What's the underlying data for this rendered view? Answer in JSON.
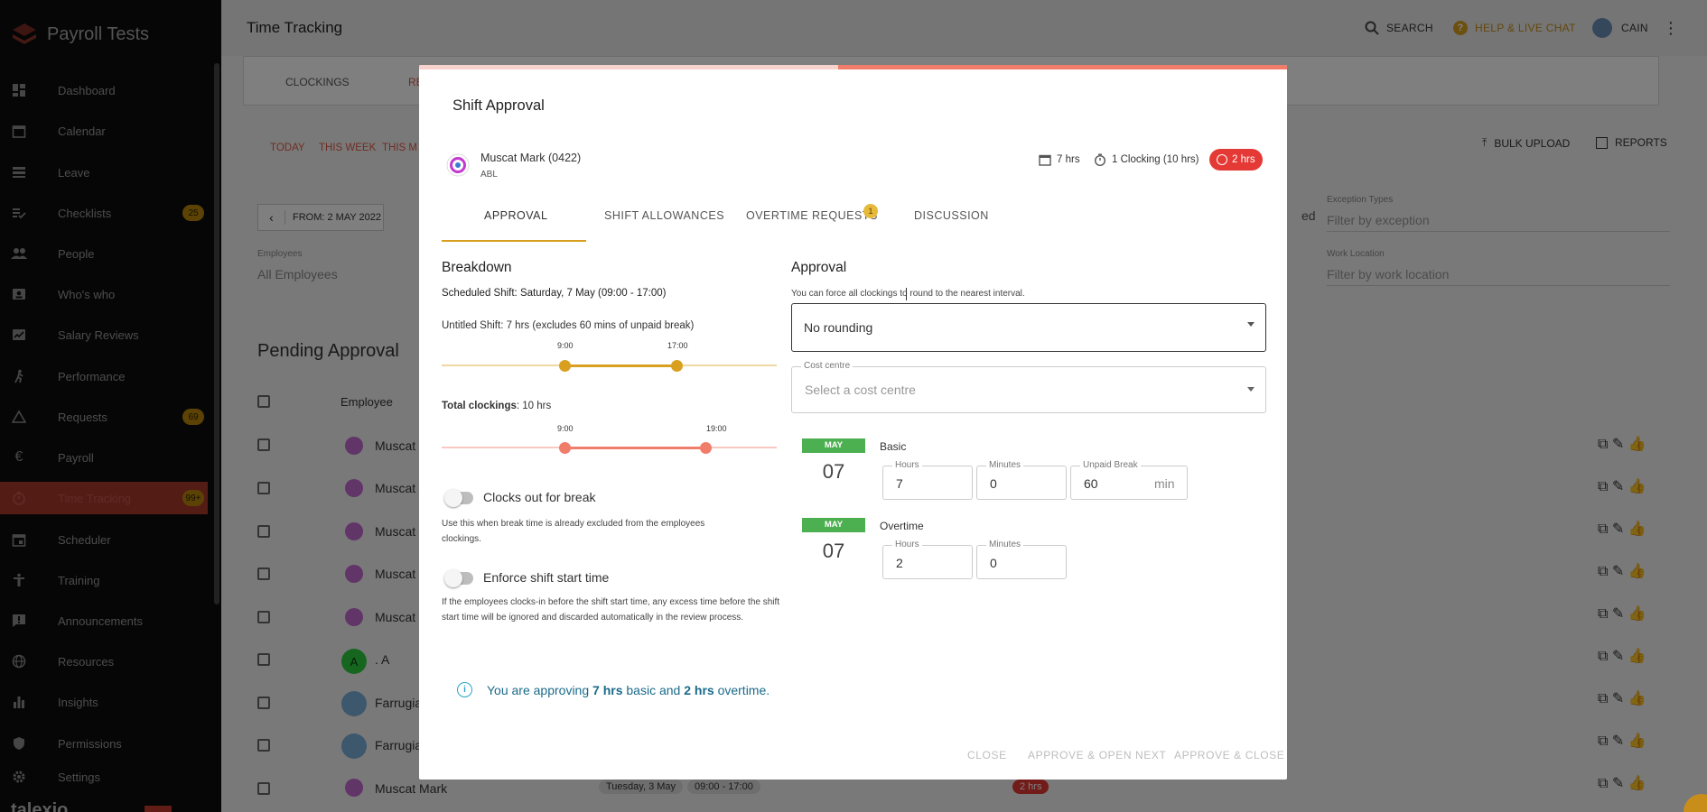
{
  "app": {
    "name": "Payroll Tests"
  },
  "sidebar": {
    "items": [
      {
        "label": "Dashboard",
        "icon": "dashboard-icon"
      },
      {
        "label": "Calendar",
        "icon": "calendar-icon"
      },
      {
        "label": "Leave",
        "icon": "leave-icon"
      },
      {
        "label": "Checklists",
        "icon": "checklist-icon",
        "badge": "25"
      },
      {
        "label": "People",
        "icon": "people-icon"
      },
      {
        "label": "Who's who",
        "icon": "badge-icon"
      },
      {
        "label": "Salary Reviews",
        "icon": "salary-review-icon"
      },
      {
        "label": "Performance",
        "icon": "run-icon"
      },
      {
        "label": "Requests",
        "icon": "warning-triangle-icon",
        "badge": "69"
      },
      {
        "label": "Payroll",
        "icon": "euro-icon"
      },
      {
        "label": "Time Tracking",
        "icon": "timer-icon",
        "badge": "99+",
        "active": true
      },
      {
        "label": "Scheduler",
        "icon": "scheduler-icon"
      },
      {
        "label": "Training",
        "icon": "training-icon"
      },
      {
        "label": "Announcements",
        "icon": "announcement-icon"
      },
      {
        "label": "Resources",
        "icon": "globe-icon"
      },
      {
        "label": "Insights",
        "icon": "bar-chart-icon"
      },
      {
        "label": "Permissions",
        "icon": "shield-icon"
      },
      {
        "label": "Settings",
        "icon": "gear-icon"
      }
    ],
    "footer_brand": "talexio"
  },
  "topbar": {
    "title": "Time Tracking",
    "search": "SEARCH",
    "help": "HELP & LIVE CHAT",
    "user": "CAIN"
  },
  "background": {
    "tabs": [
      "CLOCKINGS",
      "RE"
    ],
    "quick_filters": [
      "TODAY",
      "THIS WEEK",
      "THIS M"
    ],
    "date_from": "FROM: 2 MAY 2022",
    "bulk_upload": "BULK UPLOAD",
    "reports": "REPORTS",
    "employees_label": "Employees",
    "employees_value": "All Employees",
    "exception_label": "Exception Types",
    "exception_placeholder": "Filter by exception",
    "work_location_label": "Work Location",
    "work_location_placeholder": "Filter by work location",
    "ed_fragment": "ed",
    "pending_title": "Pending Approval",
    "column_employee": "Employee",
    "rows": [
      "Muscat",
      "Muscat",
      "Muscat",
      "Muscat",
      "Muscat",
      ". A",
      "Farrugia",
      "Farrugia",
      "Muscat Mark"
    ],
    "last_row_date": "Tuesday, 3 May",
    "last_row_time": "09:00 - 17:00",
    "last_row_badge": "2 hrs"
  },
  "modal": {
    "title": "Shift Approval",
    "employee_name": "Muscat Mark (0422)",
    "employee_sub": "ABL",
    "stat_scheduled": "7 hrs",
    "stat_clockings": "1 Clocking (10 hrs)",
    "stat_overtime": "2 hrs",
    "tabs": [
      "APPROVAL",
      "SHIFT ALLOWANCES",
      "OVERTIME REQUESTS",
      "DISCUSSION"
    ],
    "overtime_badge": "1",
    "breakdown": {
      "heading": "Breakdown",
      "scheduled": "Scheduled Shift: Saturday, 7 May (09:00 - 17:00)",
      "untitled": "Untitled Shift: 7 hrs (excludes 60 mins of unpaid break)",
      "shift_start": "9:00",
      "shift_end": "17:00",
      "total_label": "Total clockings",
      "total_value": ": 10 hrs",
      "clock_start": "9:00",
      "clock_end": "19:00",
      "break_toggle": "Clocks out for break",
      "break_help": "Use this when break time is already excluded from the employees clockings.",
      "enforce_toggle": "Enforce shift start time",
      "enforce_help": "If the employees clocks-in before the shift start time, any excess time before the shift start time will be ignored and discarded automatically in the review process."
    },
    "approval": {
      "heading": "Approval",
      "rounding_help": "You can force all clockings to round to the nearest interval.",
      "rounding_value": "No rounding",
      "cost_label": "Cost centre",
      "cost_placeholder": "Select a cost centre",
      "basic": {
        "month": "MAY",
        "day": "07",
        "label": "Basic",
        "hours_label": "Hours",
        "hours": "7",
        "minutes_label": "Minutes",
        "minutes": "0",
        "break_label": "Unpaid Break",
        "break": "60",
        "break_unit": "min"
      },
      "overtime": {
        "month": "MAY",
        "day": "07",
        "label": "Overtime",
        "hours_label": "Hours",
        "hours": "2",
        "minutes_label": "Minutes",
        "minutes": "0"
      }
    },
    "summary": {
      "pre": "You are approving ",
      "basic": "7 hrs",
      "mid": " basic and ",
      "ot": "2 hrs",
      "post": " overtime."
    },
    "buttons": {
      "close": "CLOSE",
      "approve_next": "APPROVE & OPEN NEXT",
      "approve_close": "APPROVE & CLOSE"
    }
  },
  "colors": {
    "accent": "#f07c6a",
    "shift": "#d9a020",
    "success": "#4caf50",
    "danger": "#e53935"
  }
}
